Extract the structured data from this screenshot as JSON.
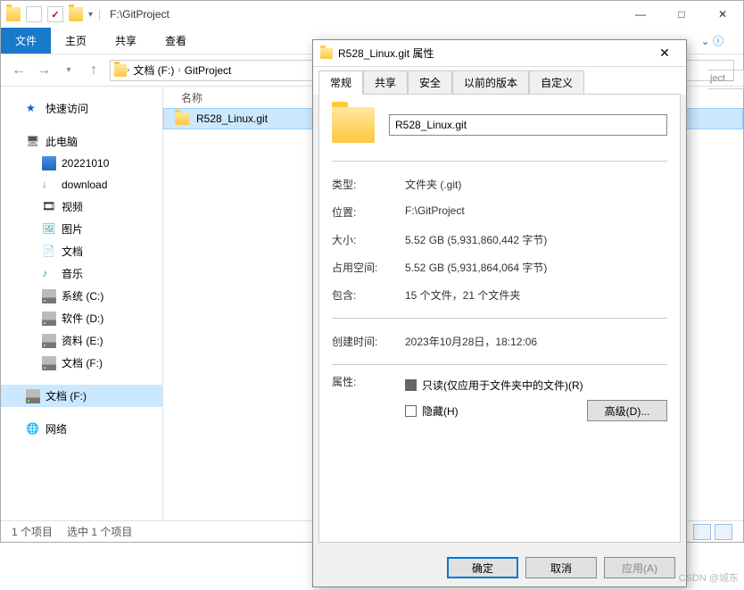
{
  "window": {
    "title": "F:\\GitProject",
    "controls": {
      "min": "—",
      "max": "□",
      "close": "✕"
    }
  },
  "ribbon": {
    "file": "文件",
    "home": "主页",
    "share": "共享",
    "view": "查看"
  },
  "nav": {
    "back": "←",
    "fwd": "→",
    "up": "↑",
    "refresh": "↻",
    "breadcrumb": [
      "文档 (F:)",
      "GitProject"
    ]
  },
  "navpane": {
    "quick": "快速访问",
    "pc": "此电脑",
    "desktop": "20221010",
    "downloads": "download",
    "videos": "视频",
    "pictures": "图片",
    "docs": "文档",
    "music": "音乐",
    "cdrive": "系统 (C:)",
    "ddrive": "软件 (D:)",
    "edrive": "资料 (E:)",
    "fdrive": "文档 (F:)",
    "fdrive_sel": "文档 (F:)",
    "network": "网络"
  },
  "filelist": {
    "col_name": "名称",
    "items": [
      "R528_Linux.git"
    ]
  },
  "statusbar": {
    "count": "1 个项目",
    "selected": "选中 1 个项目"
  },
  "partial": "ject...",
  "dialog": {
    "title": "R528_Linux.git 属性",
    "close": "✕",
    "tabs": {
      "general": "常规",
      "share": "共享",
      "security": "安全",
      "prev": "以前的版本",
      "custom": "自定义"
    },
    "name": "R528_Linux.git",
    "labels": {
      "type": "类型:",
      "location": "位置:",
      "size": "大小:",
      "ondisk": "占用空间:",
      "contains": "包含:",
      "created": "创建时间:",
      "attrs": "属性:"
    },
    "values": {
      "type": "文件夹 (.git)",
      "location": "F:\\GitProject",
      "size": "5.52 GB (5,931,860,442 字节)",
      "ondisk": "5.52 GB (5,931,864,064 字节)",
      "contains": "15 个文件，21 个文件夹",
      "created": "2023年10月28日，18:12:06"
    },
    "attrs": {
      "readonly": "只读(仅应用于文件夹中的文件)(R)",
      "hidden": "隐藏(H)",
      "advanced": "高级(D)..."
    },
    "buttons": {
      "ok": "确定",
      "cancel": "取消",
      "apply": "应用(A)"
    }
  },
  "watermark": "CSDN @城东"
}
